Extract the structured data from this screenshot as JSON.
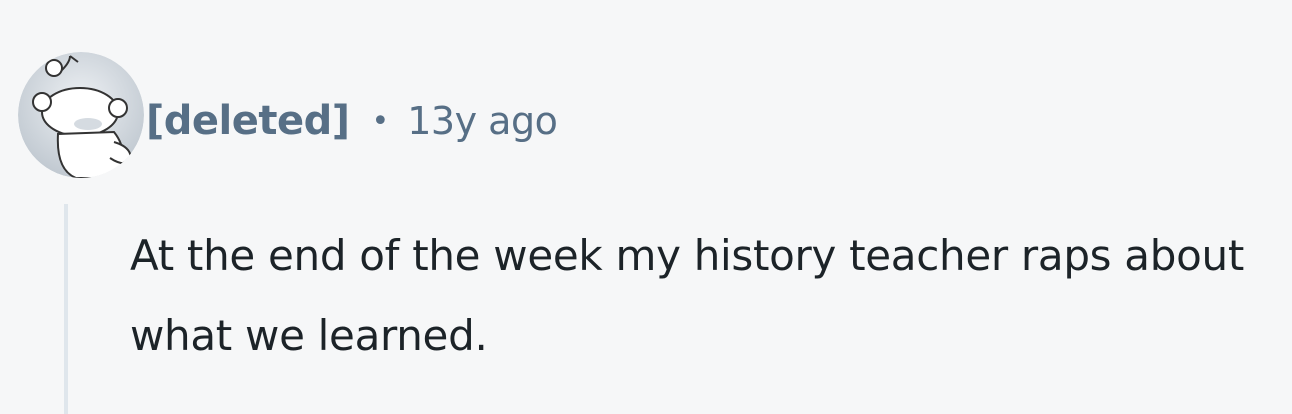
{
  "comment": {
    "author": "[deleted]",
    "separator": "•",
    "timestamp": "13y ago",
    "body": "At the end of the week my history teacher raps about what we learned.",
    "avatar_icon": "snoo-avatar-icon"
  },
  "colors": {
    "background": "#f6f7f8",
    "meta_text": "#576f86",
    "body_text": "#1c2328",
    "thread_line": "#dfe6ec"
  }
}
